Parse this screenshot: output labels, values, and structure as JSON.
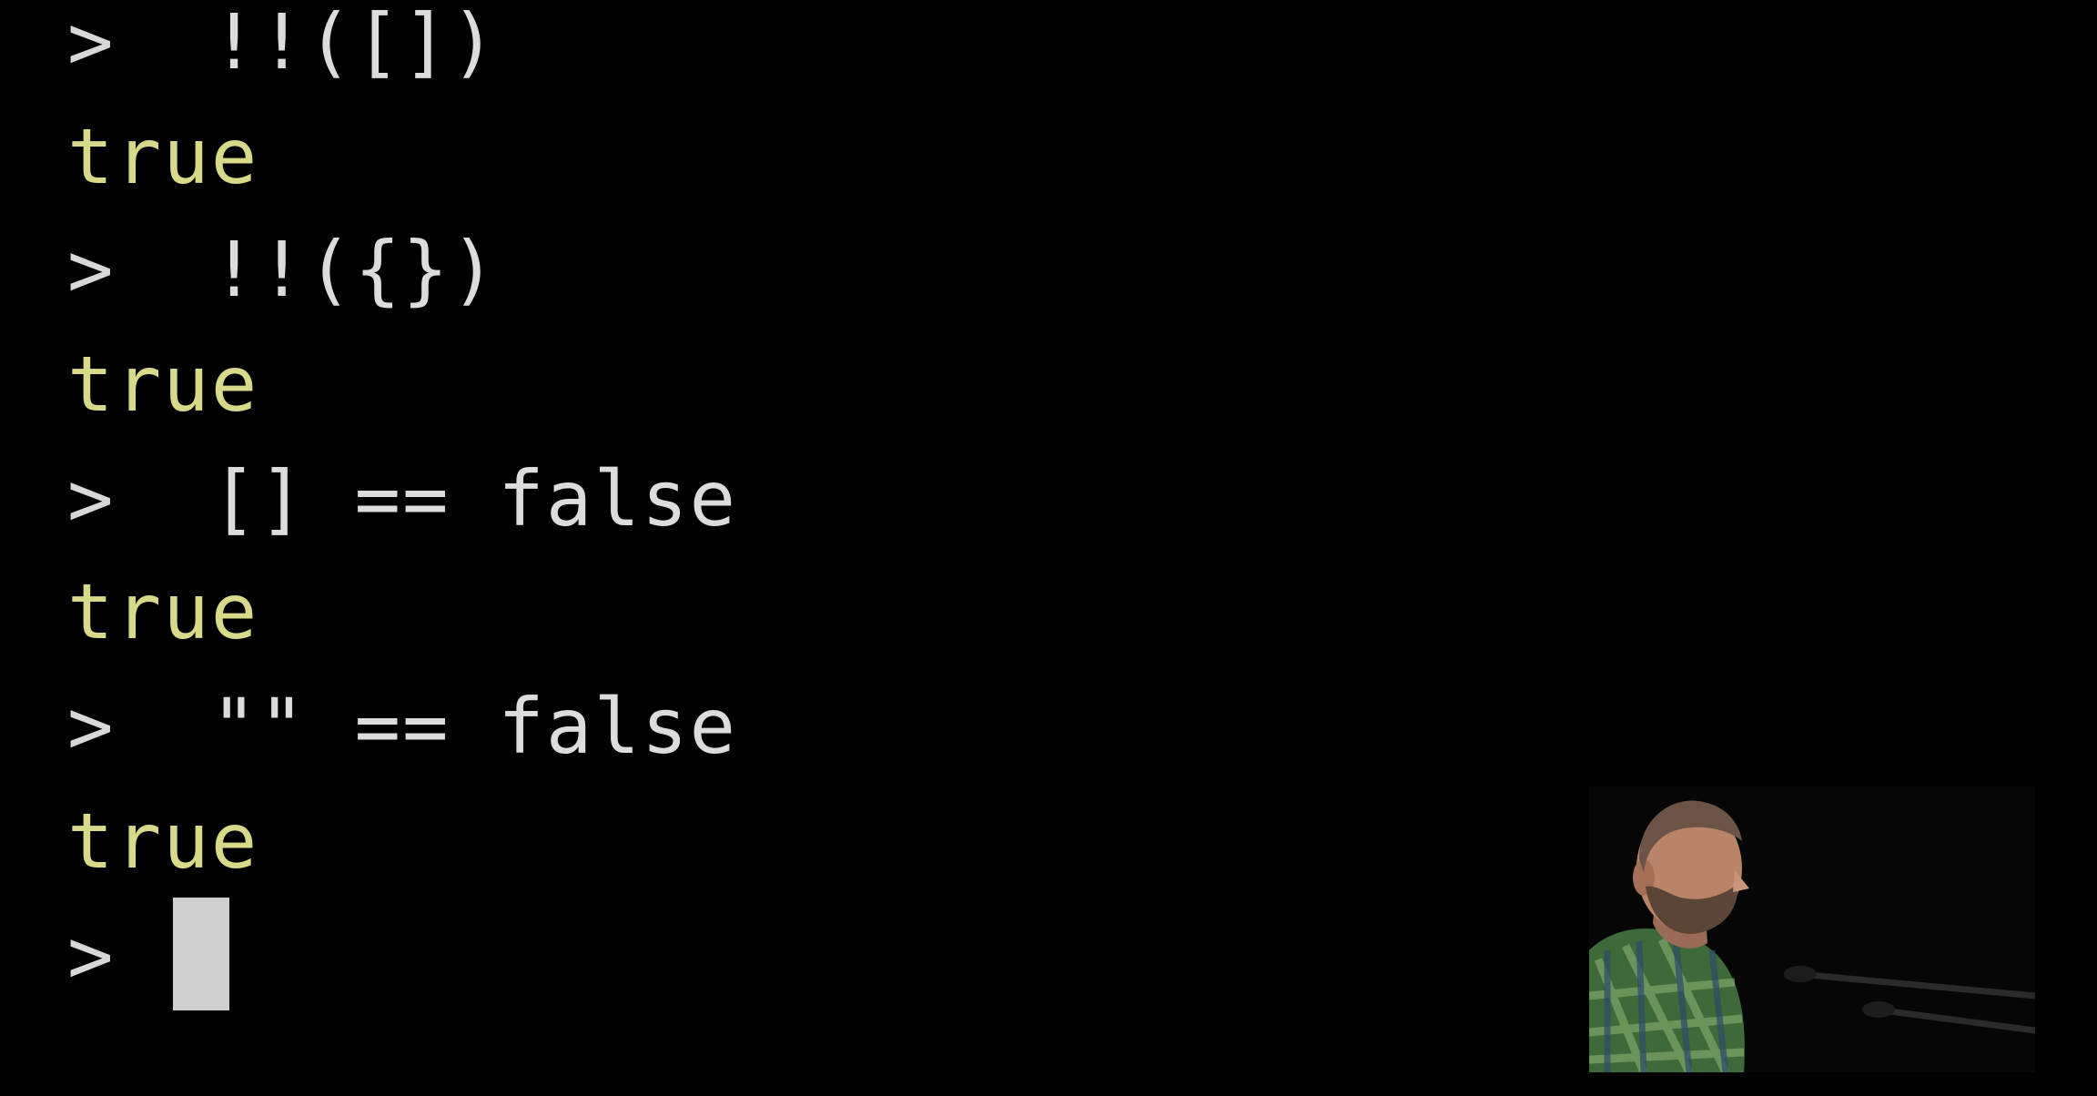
{
  "terminal": {
    "prompt_symbol": ">",
    "lines": [
      {
        "kind": "input",
        "prompt": ">",
        "text": "!!([])"
      },
      {
        "kind": "output",
        "text": "true"
      },
      {
        "kind": "input",
        "prompt": ">",
        "text": "!!({})"
      },
      {
        "kind": "output",
        "text": "true"
      },
      {
        "kind": "input",
        "prompt": ">",
        "text": "[] == false"
      },
      {
        "kind": "output",
        "text": "true"
      },
      {
        "kind": "input",
        "prompt": ">",
        "text": "\"\" == false"
      },
      {
        "kind": "output",
        "text": "true"
      },
      {
        "kind": "input",
        "prompt": ">",
        "text": ""
      }
    ]
  },
  "colors": {
    "background": "#000000",
    "input_text": "#dcdcdc",
    "output_text": "#d9d98a",
    "cursor": "#cfcfcf"
  },
  "video_inset": {
    "icon": "speaker-video-icon"
  }
}
